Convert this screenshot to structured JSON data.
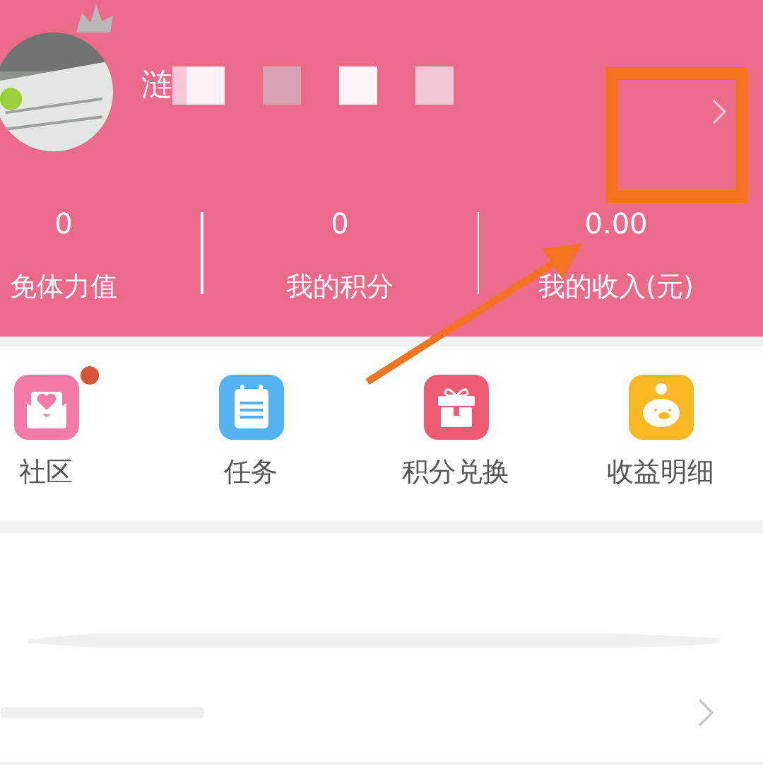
{
  "profile": {
    "name": "涟"
  },
  "stats": [
    {
      "value": "0",
      "label": "免体力值"
    },
    {
      "value": "0",
      "label": "我的积分"
    },
    {
      "value": "0.00",
      "label": "我的收入(元)"
    }
  ],
  "shortcuts": [
    {
      "label": "社区",
      "kind": "community",
      "color": "#f57aa9",
      "badge": true
    },
    {
      "label": "任务",
      "kind": "task",
      "color": "#55b2f0",
      "badge": false
    },
    {
      "label": "积分兑换",
      "kind": "gift",
      "color": "#ef5a74",
      "badge": false
    },
    {
      "label": "收益明细",
      "kind": "piggy",
      "color": "#f9b922",
      "badge": false
    }
  ]
}
